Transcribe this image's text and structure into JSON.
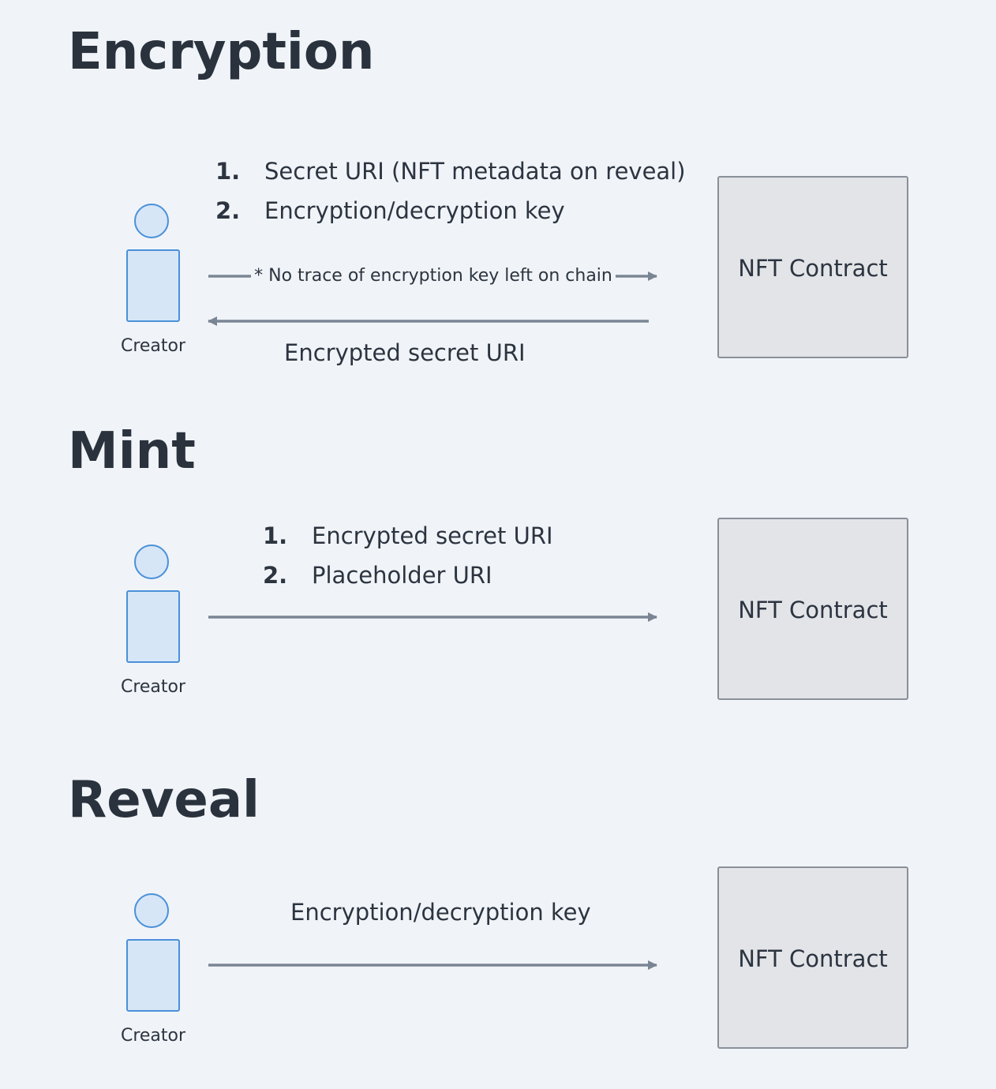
{
  "sections": [
    {
      "title": "Encryption",
      "actor_label": "Creator",
      "contract_label": "NFT Contract",
      "list_items": [
        {
          "number": "1.",
          "text": "Secret URI (NFT metadata on reveal)"
        },
        {
          "number": "2.",
          "text": "Encryption/decryption key"
        }
      ],
      "forward_arrow_note": "* No trace of encryption key left on chain",
      "return_arrow_label": "Encrypted secret URI"
    },
    {
      "title": "Mint",
      "actor_label": "Creator",
      "contract_label": "NFT Contract",
      "list_items": [
        {
          "number": "1.",
          "text": "Encrypted secret URI"
        },
        {
          "number": "2.",
          "text": "Placeholder URI"
        }
      ]
    },
    {
      "title": "Reveal",
      "actor_label": "Creator",
      "contract_label": "NFT Contract",
      "arrow_label": "Encryption/decryption key"
    }
  ],
  "colors": {
    "background": "#f0f4f8",
    "actor_stroke": "#4a90d9",
    "actor_fill": "#d6e6f7",
    "contract_fill": "#e2e4e8",
    "contract_stroke": "#8a9099",
    "arrow": "#7a8594",
    "text": "#2c3440"
  }
}
